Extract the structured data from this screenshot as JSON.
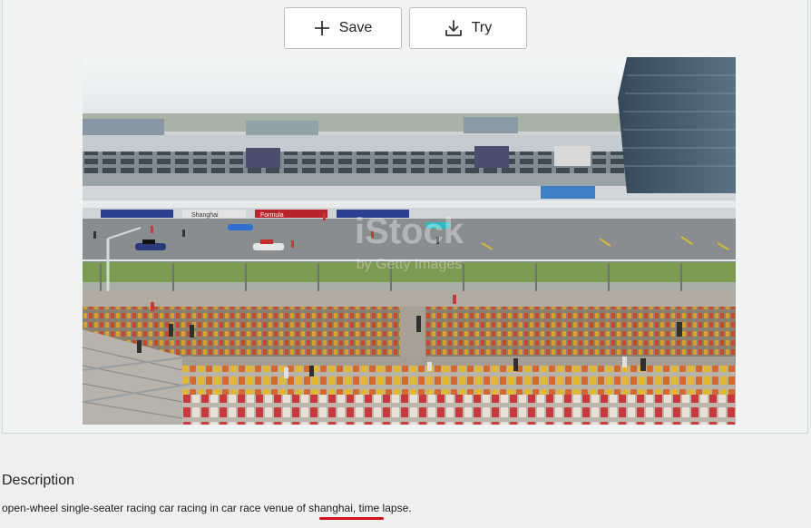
{
  "toolbar": {
    "save_label": "Save",
    "save_icon": "plus-icon",
    "try_label": "Try",
    "try_icon": "download-icon"
  },
  "image": {
    "watermark_main": "iStock",
    "watermark_sub": "by Getty Images",
    "banner_text_1": "Shanghai",
    "banner_text_2": "Formula"
  },
  "description": {
    "title": "Description",
    "text": "open-wheel single-seater racing car racing in car race venue of shanghai, time lapse."
  },
  "colors": {
    "accent_underline": "#d0121f",
    "button_border": "#b9bcbc",
    "page_background": "#eef0f0"
  }
}
